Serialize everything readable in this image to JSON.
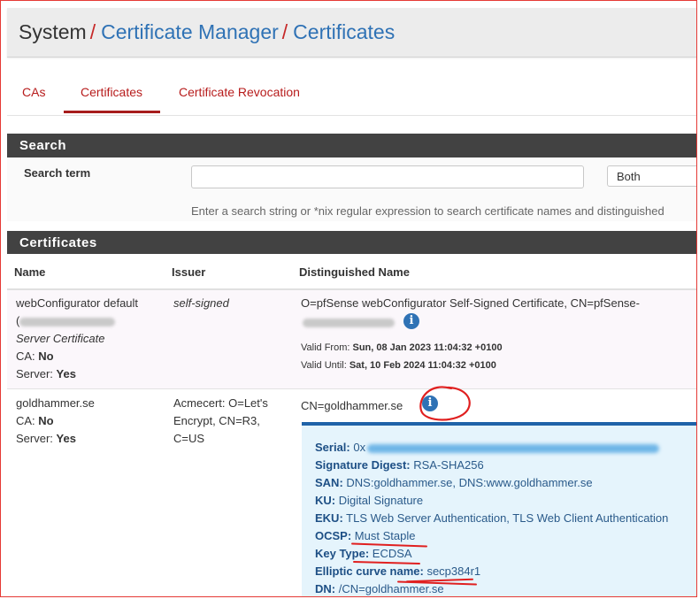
{
  "breadcrumb": {
    "root": "System",
    "sep": "/",
    "level2": "Certificate Manager",
    "level3": "Certificates"
  },
  "tabs": [
    {
      "label": "CAs",
      "active": false
    },
    {
      "label": "Certificates",
      "active": true
    },
    {
      "label": "Certificate Revocation",
      "active": false
    }
  ],
  "search_panel": {
    "title": "Search",
    "term_label": "Search term",
    "input_value": "",
    "scope_selected": "Both",
    "help_text": "Enter a search string or *nix regular expression to search certificate names and distinguished"
  },
  "certs_panel": {
    "title": "Certificates",
    "columns": [
      "Name",
      "Issuer",
      "Distinguished Name"
    ]
  },
  "rows": [
    {
      "name": "webConfigurator default",
      "paren_open": "(",
      "type": "Server Certificate",
      "ca_label": "CA:",
      "ca_value": "No",
      "server_label": "Server:",
      "server_value": "Yes",
      "issuer": "self-signed",
      "dn": "O=pfSense webConfigurator Self-Signed Certificate, CN=pfSense-",
      "valid_from_label": "Valid From:",
      "valid_from": "Sun, 08 Jan 2023 11:04:32 +0100",
      "valid_until_label": "Valid Until:",
      "valid_until": "Sat, 10 Feb 2024 11:04:32 +0100"
    },
    {
      "name": "goldhammer.se",
      "ca_label": "CA:",
      "ca_value": "No",
      "server_label": "Server:",
      "server_value": "Yes",
      "issuer_line1": "Acmecert: O=Let's",
      "issuer_line2": "Encrypt, CN=R3,",
      "issuer_line3": "C=US",
      "dn": "CN=goldhammer.se",
      "details": [
        {
          "key": "Serial:",
          "value": "0x"
        },
        {
          "key": "Signature Digest:",
          "value": "RSA-SHA256"
        },
        {
          "key": "SAN:",
          "value": "DNS:goldhammer.se, DNS:www.goldhammer.se"
        },
        {
          "key": "KU:",
          "value": "Digital Signature"
        },
        {
          "key": "EKU:",
          "value": "TLS Web Server Authentication, TLS Web Client Authentication"
        },
        {
          "key": "OCSP:",
          "value": "Must Staple"
        },
        {
          "key": "Key Type:",
          "value": "ECDSA"
        },
        {
          "key": "Elliptic curve name:",
          "value": "secp384r1"
        },
        {
          "key": "DN:",
          "value": "/CN=goldhammer.se"
        }
      ]
    }
  ],
  "icons": {
    "info": "info-circle-icon"
  },
  "colors": {
    "accent": "#2f72b5",
    "tab_red": "#b71c1c",
    "panel_dark": "#424242",
    "annotation_red": "#e02020"
  }
}
